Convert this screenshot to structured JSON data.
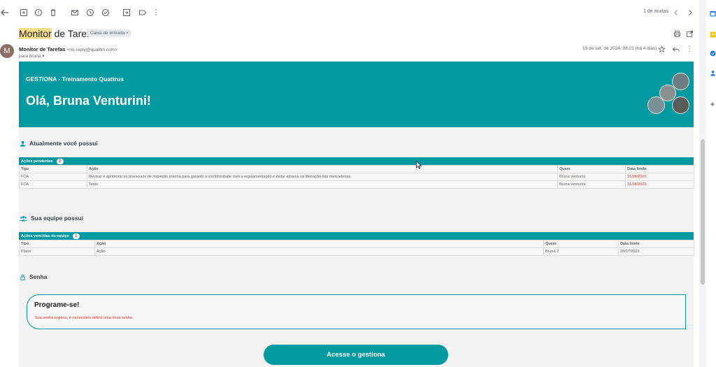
{
  "toolbar": {
    "pager_text": "1 de muitas"
  },
  "subject": {
    "highlight": "Monitor",
    "rest": " de Tarefas",
    "label_chip": "Caixa de entrada ×"
  },
  "sender": {
    "avatar_letter": "M",
    "name": "Monitor de Tarefas",
    "email": "<no-reply@qualitin.com>",
    "to": "para bruna ▾",
    "date": "13 de set. de 2024, 08:23 (há 4 dias)"
  },
  "banner": {
    "subtitle": "GESTIONA - Treinamento Quattrus",
    "greeting": "Olá, Bruna Venturini!"
  },
  "section_mine": {
    "title": "Atualmente você possui",
    "table_title": "Ações pendentes",
    "count": "2",
    "columns": [
      "Tipo",
      "Ação",
      "Quem",
      "Data limite"
    ],
    "rows": [
      [
        "FCA",
        "Revisar e aprimorar os processos de inspeção interna para garantir a conformidade com a regulamentação e evitar atrasos na liberação das mercadorias.",
        "Bruna venturini",
        "31/08/2023"
      ],
      [
        "FCA",
        "Teste",
        "Bruna venturini",
        "31/08/2023"
      ]
    ]
  },
  "section_team": {
    "title": "Sua equipe possui",
    "table_title": "Ações vencidas da equipe",
    "count": "1",
    "columns": [
      "Tipo",
      "Ação",
      "Quem",
      "Data limite"
    ],
    "rows": [
      [
        "Plano",
        "Ação",
        "Bruna 2",
        "28/07/2023"
      ]
    ]
  },
  "section_password": {
    "title": "Senha",
    "box_title": "Programe-se!",
    "message": "Sua senha expirou, é necessário definir uma nova senha."
  },
  "cta_label": "Acesse o gestiona",
  "colors": {
    "brand": "#009aa0",
    "alert": "#d93025",
    "highlight": "#fbe08a"
  }
}
